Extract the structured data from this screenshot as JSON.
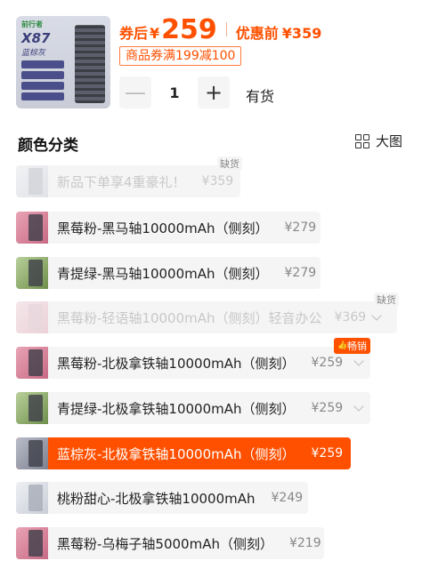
{
  "product": {
    "image": {
      "brand": "前行者",
      "model": "X87",
      "color_name": "蓝棕灰",
      "icon": "keyboard-product-image"
    },
    "after_coupon_label": "券后",
    "currency": "¥",
    "after_coupon_price": "259",
    "before_discount_label": "优惠前",
    "before_discount_price": "¥359",
    "coupon_text": "商品券满199减100",
    "quantity": "1",
    "minus_symbol": "—",
    "plus_symbol": "+",
    "stock_status": "有货"
  },
  "colors": {
    "accent": "#ff5000",
    "option_bg": "#f5f5f5"
  },
  "section": {
    "title": "颜色分类",
    "view_toggle_label": "大图"
  },
  "options": [
    {
      "label": "新品下单享4重豪礼！",
      "price": "¥359",
      "badge": "缺货",
      "disabled": true,
      "selected": false,
      "image": "white"
    },
    {
      "label": "黑莓粉-黑马轴10000mAh（侧刻）",
      "price": "¥279",
      "badge": "",
      "disabled": false,
      "selected": false,
      "image": "pink"
    },
    {
      "label": "青提绿-黑马轴10000mAh（侧刻）",
      "price": "¥279",
      "badge": "",
      "disabled": false,
      "selected": false,
      "image": "green"
    },
    {
      "label": "黑莓粉-轻语轴10000mAh（侧刻）轻音办公",
      "price": "¥369",
      "badge": "缺货",
      "disabled": true,
      "selected": false,
      "image": "lightpink"
    },
    {
      "label": "黑莓粉-北极拿铁轴10000mAh（侧刻）",
      "price": "¥259",
      "badge": "畅销",
      "disabled": false,
      "selected": false,
      "image": "pink"
    },
    {
      "label": "青提绿-北极拿铁轴10000mAh（侧刻）",
      "price": "¥259",
      "badge": "",
      "disabled": false,
      "selected": false,
      "image": "green"
    },
    {
      "label": "蓝棕灰-北极拿铁轴10000mAh（侧刻）",
      "price": "¥259",
      "badge": "",
      "disabled": false,
      "selected": true,
      "image": "grey"
    },
    {
      "label": "桃粉甜心-北极拿铁轴10000mAh",
      "price": "¥249",
      "badge": "",
      "disabled": false,
      "selected": false,
      "image": "lightpink"
    },
    {
      "label": "黑莓粉-乌梅子轴5000mAh（侧刻）",
      "price": "¥219",
      "badge": "",
      "disabled": false,
      "selected": false,
      "image": "pink"
    }
  ]
}
